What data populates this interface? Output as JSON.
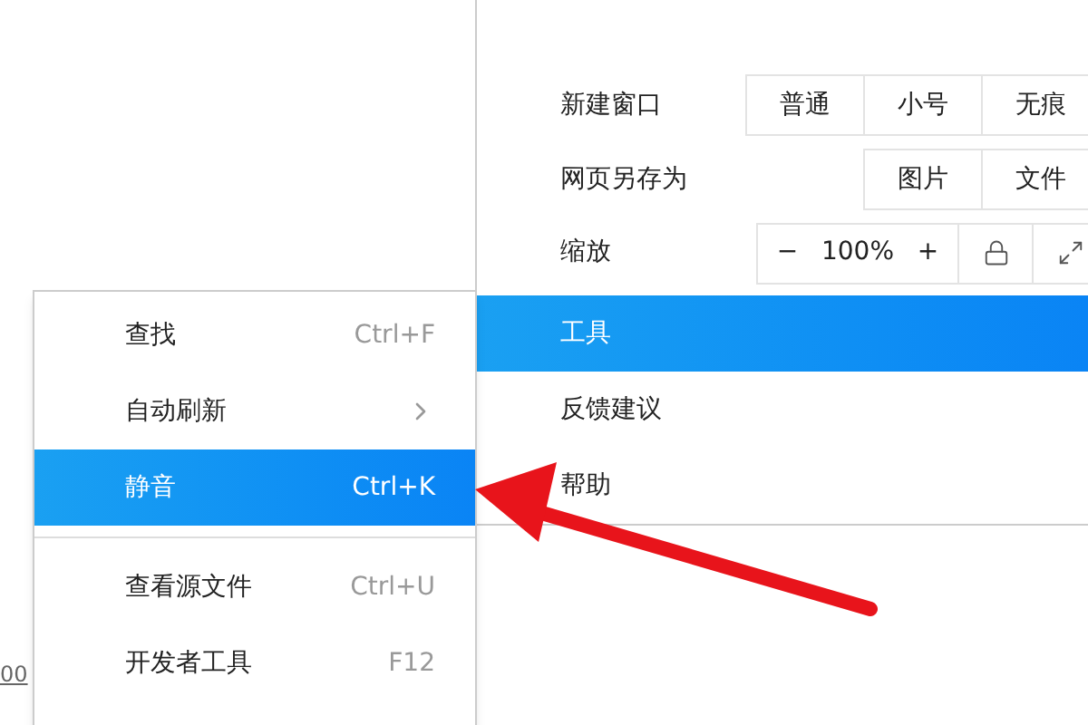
{
  "page_link": "00",
  "main_menu": {
    "rows": [
      {
        "kind": "buttons",
        "label": "新建窗口",
        "buttons": [
          "普通",
          "小号",
          "无痕"
        ]
      },
      {
        "kind": "buttons",
        "label": "网页另存为",
        "buttons": [
          "图片",
          "文件"
        ]
      },
      {
        "kind": "zoom",
        "label": "缩放",
        "minus": "−",
        "value": "100%",
        "plus": "+"
      }
    ],
    "items": [
      {
        "label": "工具",
        "selected": true
      },
      {
        "label": "反馈建议",
        "selected": false
      },
      {
        "label": "帮助",
        "selected": false
      }
    ]
  },
  "submenu": {
    "items": [
      {
        "kind": "shortcut",
        "label": "查找",
        "shortcut": "Ctrl+F",
        "selected": false
      },
      {
        "kind": "submenu",
        "label": "自动刷新",
        "selected": false
      },
      {
        "kind": "shortcut",
        "label": "静音",
        "shortcut": "Ctrl+K",
        "selected": true
      },
      {
        "kind": "separator"
      },
      {
        "kind": "shortcut",
        "label": "查看源文件",
        "shortcut": "Ctrl+U",
        "selected": false
      },
      {
        "kind": "shortcut",
        "label": "开发者工具",
        "shortcut": "F12",
        "selected": false
      }
    ]
  }
}
